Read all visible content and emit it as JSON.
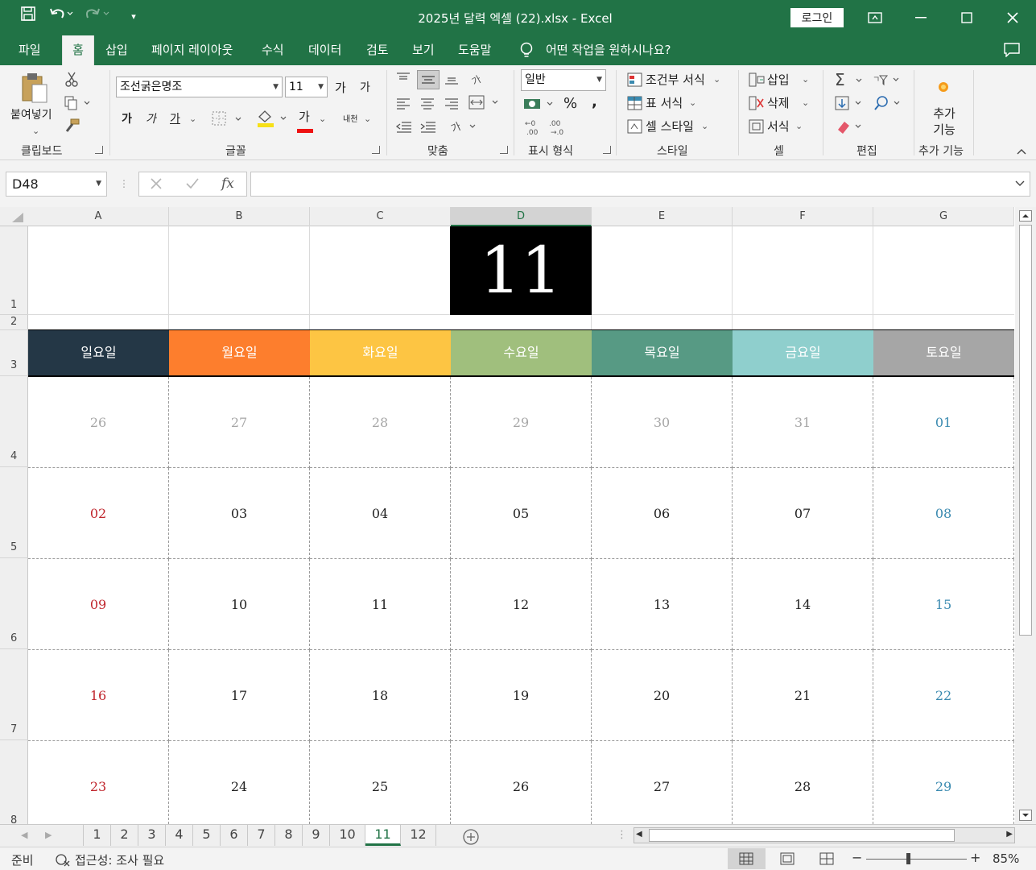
{
  "window": {
    "title": "2025년 달력 엑셀 (22).xlsx  -  Excel",
    "login_label": "로그인"
  },
  "ribbon_tabs": [
    {
      "label": "파일"
    },
    {
      "label": "홈"
    },
    {
      "label": "삽입"
    },
    {
      "label": "페이지 레이아웃"
    },
    {
      "label": "수식"
    },
    {
      "label": "데이터"
    },
    {
      "label": "검토"
    },
    {
      "label": "보기"
    },
    {
      "label": "도움말"
    }
  ],
  "tell_me": "어떤 작업을 원하시나요?",
  "ribbon": {
    "clipboard": {
      "paste_label": "붙여넣기",
      "group_label": "클립보드"
    },
    "font": {
      "font_name": "조선굵은명조",
      "font_size": "11",
      "group_label": "글꼴",
      "bold": "가",
      "italic": "가",
      "underline": "가",
      "font_color": "가",
      "grow": "가",
      "shrink": "가",
      "phonetic": "내천"
    },
    "alignment": {
      "group_label": "맞춤"
    },
    "number": {
      "format": "일반",
      "percent": "%",
      "comma": ",",
      "group_label": "표시 형식"
    },
    "styles": {
      "conditional": "조건부 서식",
      "table": "표 서식",
      "cell_style": "셀 스타일",
      "group_label": "스타일"
    },
    "cells": {
      "insert": "삽입",
      "delete": "삭제",
      "format": "서식",
      "group_label": "셀"
    },
    "editing": {
      "group_label": "편집"
    },
    "addins": {
      "label": "추가 기능",
      "group_label": "추가 기능"
    }
  },
  "formula_bar": {
    "name_box": "D48",
    "fx": "fx",
    "formula": ""
  },
  "columns": [
    "A",
    "B",
    "C",
    "D",
    "E",
    "F",
    "G"
  ],
  "selected_column": "D",
  "rows": [
    "1",
    "2",
    "3",
    "4",
    "5",
    "6",
    "7",
    "8"
  ],
  "calendar": {
    "month": "11",
    "weekdays": [
      {
        "label": "일요일",
        "color": "#243746"
      },
      {
        "label": "월요일",
        "color": "#fd7e2d"
      },
      {
        "label": "화요일",
        "color": "#fdc543"
      },
      {
        "label": "수요일",
        "color": "#a0bf7d"
      },
      {
        "label": "목요일",
        "color": "#579a84"
      },
      {
        "label": "금요일",
        "color": "#8fcfcd"
      },
      {
        "label": "토요일",
        "color": "#a6a6a6"
      }
    ],
    "weeks": [
      [
        "26",
        "27",
        "28",
        "29",
        "30",
        "31",
        "01"
      ],
      [
        "02",
        "03",
        "04",
        "05",
        "06",
        "07",
        "08"
      ],
      [
        "09",
        "10",
        "11",
        "12",
        "13",
        "14",
        "15"
      ],
      [
        "16",
        "17",
        "18",
        "19",
        "20",
        "21",
        "22"
      ],
      [
        "23",
        "24",
        "25",
        "26",
        "27",
        "28",
        "29"
      ]
    ],
    "colors": {
      "sunday": "#c0262d",
      "saturday": "#3a8ab0",
      "weekday": "#222222",
      "other_month": "#a6a6a6"
    }
  },
  "sheet_tabs": [
    "1",
    "2",
    "3",
    "4",
    "5",
    "6",
    "7",
    "8",
    "9",
    "10",
    "11",
    "12"
  ],
  "active_sheet": "11",
  "status": {
    "ready": "준비",
    "accessibility": "접근성: 조사 필요",
    "zoom": "85%"
  }
}
